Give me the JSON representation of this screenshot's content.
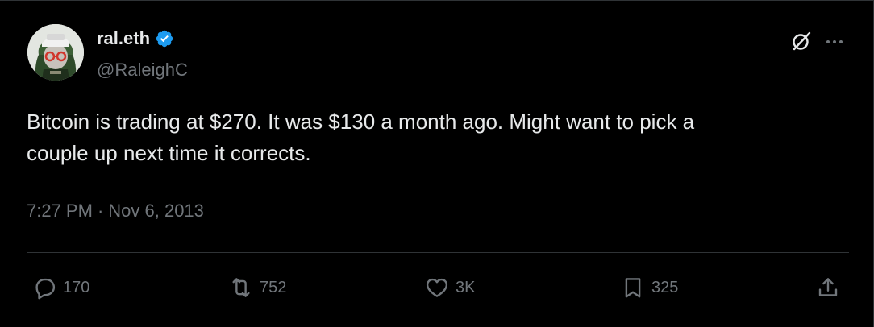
{
  "author": {
    "display_name": "ral.eth",
    "handle": "@RaleighC",
    "verified": true,
    "verified_color": "#1d9bf0"
  },
  "tweet": {
    "text": "Bitcoin is trading at $270. It was $130 a month ago. Might want to pick a\ncouple up next time it corrects.",
    "time": "7:27 PM",
    "separator": "·",
    "date": "Nov 6, 2013"
  },
  "actions": {
    "replies": "170",
    "reposts": "752",
    "likes": "3K",
    "bookmarks": "325"
  },
  "icons": {
    "reply": "reply-icon",
    "repost": "repost-icon",
    "like": "heart-icon",
    "bookmark": "bookmark-icon",
    "share": "share-icon",
    "grok": "grok-icon",
    "more": "more-icon",
    "verified": "verified-badge-icon"
  },
  "colors": {
    "background": "#000000",
    "text_primary": "#e7e9ea",
    "text_secondary": "#71767b",
    "divider": "#2f3336"
  }
}
